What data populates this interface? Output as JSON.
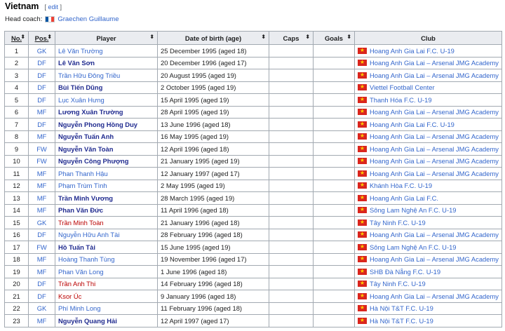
{
  "section": {
    "title": "Vietnam",
    "edit_open": "[",
    "edit_label": "edit",
    "edit_close": "]"
  },
  "coach": {
    "label": "Head coach:",
    "flag_icon": "france-flag-icon",
    "name": "Graechen Guillaume"
  },
  "columns": {
    "no": "No.",
    "pos": "Pos.",
    "player": "Player",
    "dob": "Date of birth (age)",
    "caps": "Caps",
    "goals": "Goals",
    "club": "Club"
  },
  "sort_glyph": "⬍",
  "colors": {
    "link": "#3366cc",
    "bold_link": "#202b8f",
    "redlink": "#ba0000",
    "header_bg": "#eaecf0",
    "border": "#a2a9b1"
  },
  "rows": [
    {
      "no": "1",
      "pos": "GK",
      "player": "Lê Văn Trường",
      "style": "link",
      "dob": "25 December 1995 (aged 18)",
      "caps": "",
      "goals": "",
      "club": "Hoang Anh Gia Lai F.C. U-19"
    },
    {
      "no": "2",
      "pos": "DF",
      "player": "Lê Văn Sơn",
      "style": "bold",
      "dob": "20 December 1996 (aged 17)",
      "caps": "",
      "goals": "",
      "club": "Hoang Anh Gia Lai – Arsenal JMG Academy"
    },
    {
      "no": "3",
      "pos": "DF",
      "player": "Trần Hữu Đông Triều",
      "style": "link",
      "dob": "20 August 1995 (aged 19)",
      "caps": "",
      "goals": "",
      "club": "Hoang Anh Gia Lai – Arsenal JMG Academy"
    },
    {
      "no": "4",
      "pos": "DF",
      "player": "Bùi Tiến Dũng",
      "style": "bold",
      "dob": "2 October 1995 (aged 19)",
      "caps": "",
      "goals": "",
      "club": "Viettel Football Center"
    },
    {
      "no": "5",
      "pos": "DF",
      "player": "Lục Xuân Hưng",
      "style": "link",
      "dob": "15 April 1995 (aged 19)",
      "caps": "",
      "goals": "",
      "club": "Thanh Hóa F.C. U-19"
    },
    {
      "no": "6",
      "pos": "MF",
      "player": "Lương Xuân Trường",
      "style": "bold",
      "dob": "28 April 1995 (aged 19)",
      "caps": "",
      "goals": "",
      "club": "Hoang Anh Gia Lai – Arsenal JMG Academy"
    },
    {
      "no": "7",
      "pos": "DF",
      "player": "Nguyễn Phong Hồng Duy",
      "style": "bold",
      "dob": "13 June 1996 (aged 18)",
      "caps": "",
      "goals": "",
      "club": "Hoang Anh Gia Lai F.C. U-19"
    },
    {
      "no": "8",
      "pos": "MF",
      "player": "Nguyễn Tuấn Anh",
      "style": "bold",
      "dob": "16 May 1995 (aged 19)",
      "caps": "",
      "goals": "",
      "club": "Hoang Anh Gia Lai – Arsenal JMG Academy"
    },
    {
      "no": "9",
      "pos": "FW",
      "player": "Nguyễn Văn Toàn",
      "style": "bold",
      "dob": "12 April 1996 (aged 18)",
      "caps": "",
      "goals": "",
      "club": "Hoang Anh Gia Lai – Arsenal JMG Academy"
    },
    {
      "no": "10",
      "pos": "FW",
      "player": "Nguyễn Công Phượng",
      "style": "bold",
      "dob": "21 January 1995 (aged 19)",
      "caps": "",
      "goals": "",
      "club": "Hoang Anh Gia Lai – Arsenal JMG Academy"
    },
    {
      "no": "11",
      "pos": "MF",
      "player": "Phan Thanh Hậu",
      "style": "link",
      "dob": "12 January 1997 (aged 17)",
      "caps": "",
      "goals": "",
      "club": "Hoang Anh Gia Lai – Arsenal JMG Academy"
    },
    {
      "no": "12",
      "pos": "MF",
      "player": "Phạm Trùm Tình",
      "style": "link",
      "dob": "2 May 1995 (aged 19)",
      "caps": "",
      "goals": "",
      "club": "Khánh Hòa F.C. U-19"
    },
    {
      "no": "13",
      "pos": "MF",
      "player": "Trần Minh Vương",
      "style": "bold",
      "dob": "28 March 1995 (aged 19)",
      "caps": "",
      "goals": "",
      "club": "Hoang Anh Gia Lai F.C."
    },
    {
      "no": "14",
      "pos": "MF",
      "player": "Phan Văn Đức",
      "style": "bold",
      "dob": "11 April 1996 (aged 18)",
      "caps": "",
      "goals": "",
      "club": "Sông Lam Nghệ An F.C. U-19"
    },
    {
      "no": "15",
      "pos": "GK",
      "player": "Trần Minh Toàn",
      "style": "red",
      "dob": "21 January 1996 (aged 18)",
      "caps": "",
      "goals": "",
      "club": "Tây Ninh F.C. U-19"
    },
    {
      "no": "16",
      "pos": "DF",
      "player": "Nguyễn Hữu Anh Tài",
      "style": "link",
      "dob": "28 February 1996 (aged 18)",
      "caps": "",
      "goals": "",
      "club": "Hoang Anh Gia Lai – Arsenal JMG Academy"
    },
    {
      "no": "17",
      "pos": "FW",
      "player": "Hồ Tuấn Tài",
      "style": "bold",
      "dob": "15 June 1995 (aged 19)",
      "caps": "",
      "goals": "",
      "club": "Sông Lam Nghệ An F.C. U-19"
    },
    {
      "no": "18",
      "pos": "MF",
      "player": "Hoàng Thanh Tùng",
      "style": "link",
      "dob": "19 November 1996 (aged 17)",
      "caps": "",
      "goals": "",
      "club": "Hoang Anh Gia Lai – Arsenal JMG Academy"
    },
    {
      "no": "19",
      "pos": "MF",
      "player": "Phan Văn Long",
      "style": "link",
      "dob": "1 June 1996 (aged 18)",
      "caps": "",
      "goals": "",
      "club": "SHB Đà Nẵng F.C. U-19"
    },
    {
      "no": "20",
      "pos": "DF",
      "player": "Trần Anh Thi",
      "style": "red",
      "dob": "14 February 1996 (aged 18)",
      "caps": "",
      "goals": "",
      "club": "Tây Ninh F.C. U-19"
    },
    {
      "no": "21",
      "pos": "DF",
      "player": "Ksor Úc",
      "style": "red",
      "dob": "9 January 1996 (aged 18)",
      "caps": "",
      "goals": "",
      "club": "Hoang Anh Gia Lai – Arsenal JMG Academy"
    },
    {
      "no": "22",
      "pos": "GK",
      "player": "Phí Minh Long",
      "style": "link",
      "dob": "11 February 1996 (aged 18)",
      "caps": "",
      "goals": "",
      "club": "Hà Nội T&T F.C. U-19"
    },
    {
      "no": "23",
      "pos": "MF",
      "player": "Nguyễn Quang Hải",
      "style": "bold",
      "dob": "12 April 1997 (aged 17)",
      "caps": "",
      "goals": "",
      "club": "Hà Nội T&T F.C. U-19"
    }
  ]
}
